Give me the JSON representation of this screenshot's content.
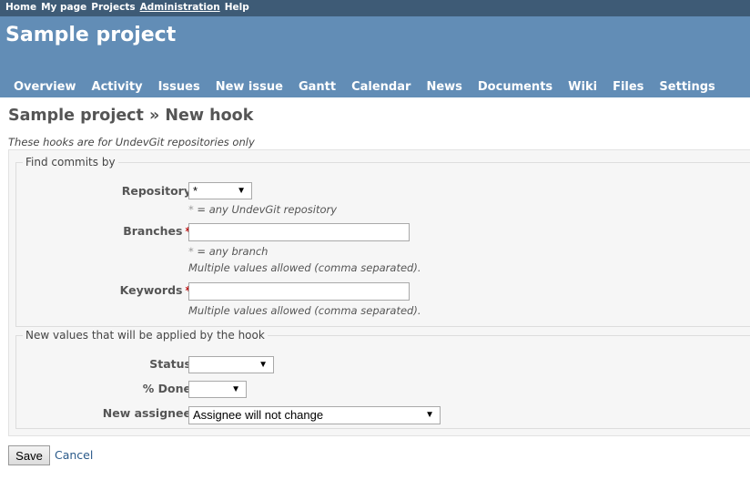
{
  "top_menu": [
    "Home",
    "My page",
    "Projects",
    "Administration",
    "Help"
  ],
  "project_title": "Sample project",
  "main_menu": [
    "Overview",
    "Activity",
    "Issues",
    "New issue",
    "Gantt",
    "Calendar",
    "News",
    "Documents",
    "Wiki",
    "Files",
    "Settings"
  ],
  "page_title": "Sample project » New hook",
  "note": "These hooks are for UndevGit repositories only",
  "find": {
    "legend": "Find commits by",
    "repository": {
      "label": "Repository",
      "value": "*",
      "hint_star": "*",
      "hint": " = any UndevGit repository"
    },
    "branches": {
      "label": "Branches",
      "required": "*",
      "value": "",
      "hint_star": "*",
      "hint": " = any branch",
      "hint2": "Multiple values allowed (comma separated)."
    },
    "keywords": {
      "label": "Keywords",
      "required": "*",
      "value": "",
      "hint": "Multiple values allowed (comma separated)."
    }
  },
  "apply": {
    "legend": "New values that will be applied by the hook",
    "status": {
      "label": "Status",
      "value": ""
    },
    "done": {
      "label": "% Done",
      "value": ""
    },
    "assignee": {
      "label": "New assignee",
      "value": "Assignee will not change"
    }
  },
  "save_label": "Save",
  "cancel_label": "Cancel"
}
